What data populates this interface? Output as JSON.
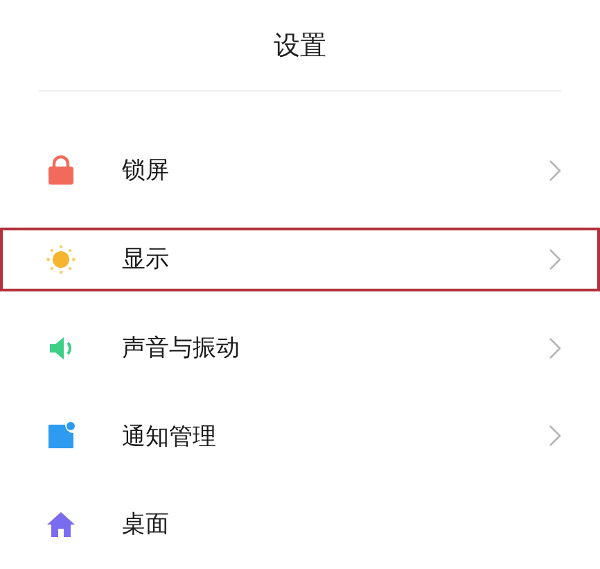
{
  "header": {
    "title": "设置"
  },
  "items": [
    {
      "kind": "lock",
      "label": "锁屏",
      "highlighted": false,
      "chevron": true
    },
    {
      "kind": "sun",
      "label": "显示",
      "highlighted": true,
      "chevron": true
    },
    {
      "kind": "speaker",
      "label": "声音与振动",
      "highlighted": false,
      "chevron": true
    },
    {
      "kind": "notification",
      "label": "通知管理",
      "highlighted": false,
      "chevron": true
    },
    {
      "kind": "home",
      "label": "桌面",
      "highlighted": false,
      "chevron": false
    }
  ]
}
